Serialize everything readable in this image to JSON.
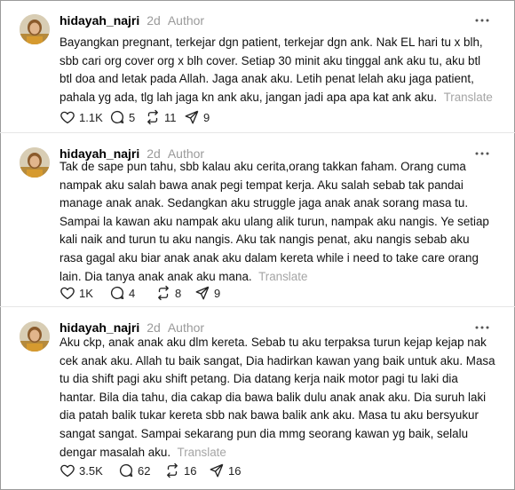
{
  "posts": [
    {
      "username": "hidayah_najri",
      "time": "2d",
      "author_badge": "Author",
      "lines": [
        "Bayangkan pregnant, terkejar dgn patient, terkejar dgn ank. Nak EL hari tu x blh,",
        "sbb cari org cover org x blh cover. Setiap 30 minit aku tinggal ank aku tu, aku btl",
        "btl doa and letak pada Allah. Jaga anak aku. Letih penat lelah aku jaga patient,",
        "pahala yg ada, tlg lah jaga kn ank aku, jangan jadi apa apa kat ank aku."
      ],
      "translate": "Translate",
      "likes": "1.1K",
      "replies": "5",
      "reposts": "11",
      "shares": "9"
    },
    {
      "username": "hidayah_najri",
      "time": "2d",
      "author_badge": "Author",
      "lines": [
        "Tak de sape pun tahu, sbb kalau aku cerita,orang takkan faham. Orang cuma",
        "nampak aku salah bawa anak pegi tempat kerja. Aku salah sebab tak pandai",
        "manage anak anak. Sedangkan aku struggle jaga anak anak sorang masa tu.",
        "Sampai la kawan aku nampak aku ulang alik turun, nampak aku nangis. Ye setiap",
        "kali naik and turun tu aku nangis. Aku tak nangis penat, aku nangis sebab aku",
        "rasa gagal aku biar anak anak aku dalam kereta while i need to take care orang",
        "lain. Dia tanya anak anak aku mana."
      ],
      "translate": "Translate",
      "likes": "1K",
      "replies": "4",
      "reposts": "8",
      "shares": "9"
    },
    {
      "username": "hidayah_najri",
      "time": "2d",
      "author_badge": "Author",
      "lines": [
        "Aku ckp, anak anak aku dlm kereta. Sebab tu aku terpaksa turun kejap kejap nak",
        "cek anak aku. Allah tu baik sangat, Dia hadirkan kawan yang baik untuk aku. Masa",
        "tu dia shift pagi aku shift petang. Dia datang kerja naik motor pagi tu laki dia",
        "hantar. Bila dia tahu, dia cakap dia bawa balik dulu anak anak aku. Dia suruh laki",
        "dia patah balik tukar kereta sbb nak bawa balik ank aku. Masa tu aku bersyukur",
        "sangat sangat. Sampai sekarang pun dia mmg seorang kawan yg baik, selalu",
        "dengar masalah aku."
      ],
      "translate": "Translate",
      "likes": "3.5K",
      "replies": "62",
      "reposts": "16",
      "shares": "16"
    }
  ]
}
